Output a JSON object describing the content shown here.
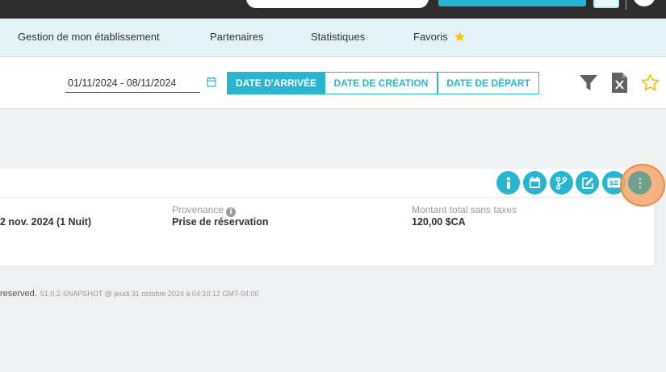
{
  "nav": {
    "items": [
      {
        "label": "Gestion de mon établissement"
      },
      {
        "label": "Partenaires"
      },
      {
        "label": "Statistiques"
      },
      {
        "label": "Favoris"
      }
    ]
  },
  "filters": {
    "date_range": "01/11/2024 - 08/11/2024",
    "buttons": [
      {
        "label": "Date d'arrivée",
        "active": true
      },
      {
        "label": "Date de création",
        "active": false
      },
      {
        "label": "Date de départ",
        "active": false
      }
    ]
  },
  "reservation": {
    "dates": "2 nov. 2024 (1 Nuit)",
    "provenance_label": "Provenance",
    "provenance_value": "Prise de réservation",
    "total_label": "Montant total sans taxes",
    "total_value": "120,00 $CA"
  },
  "footer": {
    "rights": "reserved.",
    "version": "51.0.2-SNAPSHOT @ jeudi 31 octobre 2024 à 04:10:12 GMT-04:00"
  },
  "icons": [
    "calendar-icon",
    "filter-icon",
    "excel-export-icon",
    "favorite-star-icon",
    "info-icon",
    "calendar-icon",
    "branch-icon",
    "edit-icon",
    "payment-icon",
    "more-vertical-icon"
  ],
  "colors": {
    "accent": "#27b5d1",
    "star": "#f5c518",
    "highlight": "#f08a3c",
    "nav_bg": "#e4f3f8"
  }
}
